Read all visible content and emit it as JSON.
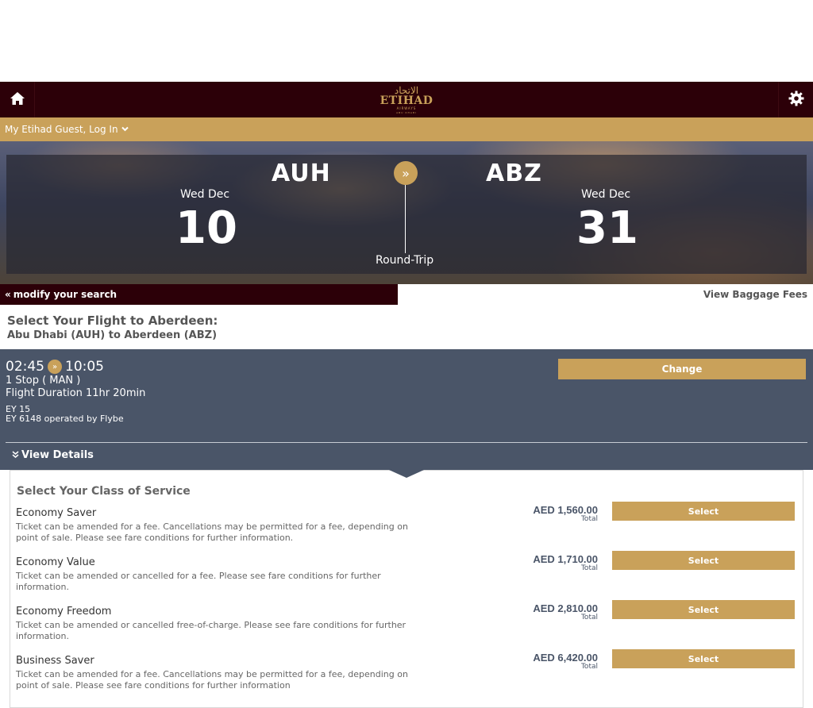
{
  "header": {
    "logo_arabic": "الاتحاد",
    "logo_main": "ETIHAD",
    "logo_sub": "AIRWAYS",
    "logo_sub2": "ABU DHABI",
    "home_icon": "home-icon",
    "settings_icon": "gear-icon"
  },
  "login": {
    "label": "My Etihad Guest, Log In"
  },
  "hero": {
    "origin_code": "AUH",
    "origin_dow": "Wed Dec",
    "origin_day": "10",
    "dest_code": "ABZ",
    "dest_dow": "Wed Dec",
    "dest_day": "31",
    "trip_type": "Round-Trip"
  },
  "modify": {
    "label": "modify your search",
    "baggage": "View Baggage Fees"
  },
  "selection": {
    "title": "Select Your Flight to Aberdeen:",
    "route": "Abu Dhabi (AUH) to Aberdeen (ABZ)"
  },
  "flight": {
    "depart": "02:45",
    "arrive": "10:05",
    "stops": "1 Stop ( MAN )",
    "duration": "Flight Duration 11hr 20min",
    "flight_no_1": "EY 15",
    "flight_no_2": "EY 6148 operated by Flybe",
    "change_label": "Change",
    "details_label": "View Details"
  },
  "classes": {
    "title": "Select Your Class of Service",
    "fares": [
      {
        "name": "Economy Saver",
        "desc": "Ticket can be amended for a fee. Cancellations may be permitted for a fee, depending on point of sale. Please see fare conditions for further information.",
        "price": "AED 1,560.00",
        "total": "Total",
        "select": "Select"
      },
      {
        "name": "Economy Value",
        "desc": "Ticket can be amended or cancelled for a fee. Please see fare conditions for further information.",
        "price": "AED 1,710.00",
        "total": "Total",
        "select": "Select"
      },
      {
        "name": "Economy Freedom",
        "desc": "Ticket can be amended or cancelled free-of-charge. Please see fare conditions for further information.",
        "price": "AED 2,810.00",
        "total": "Total",
        "select": "Select"
      },
      {
        "name": "Business Saver",
        "desc": "Ticket can be amended for a fee. Cancellations may be permitted for a fee, depending on point of sale. Please see fare conditions for further information",
        "price": "AED 6,420.00",
        "total": "Total",
        "select": "Select"
      }
    ]
  },
  "colors": {
    "maroon": "#2c0008",
    "gold": "#c9a15a",
    "slate": "#4a5568"
  }
}
